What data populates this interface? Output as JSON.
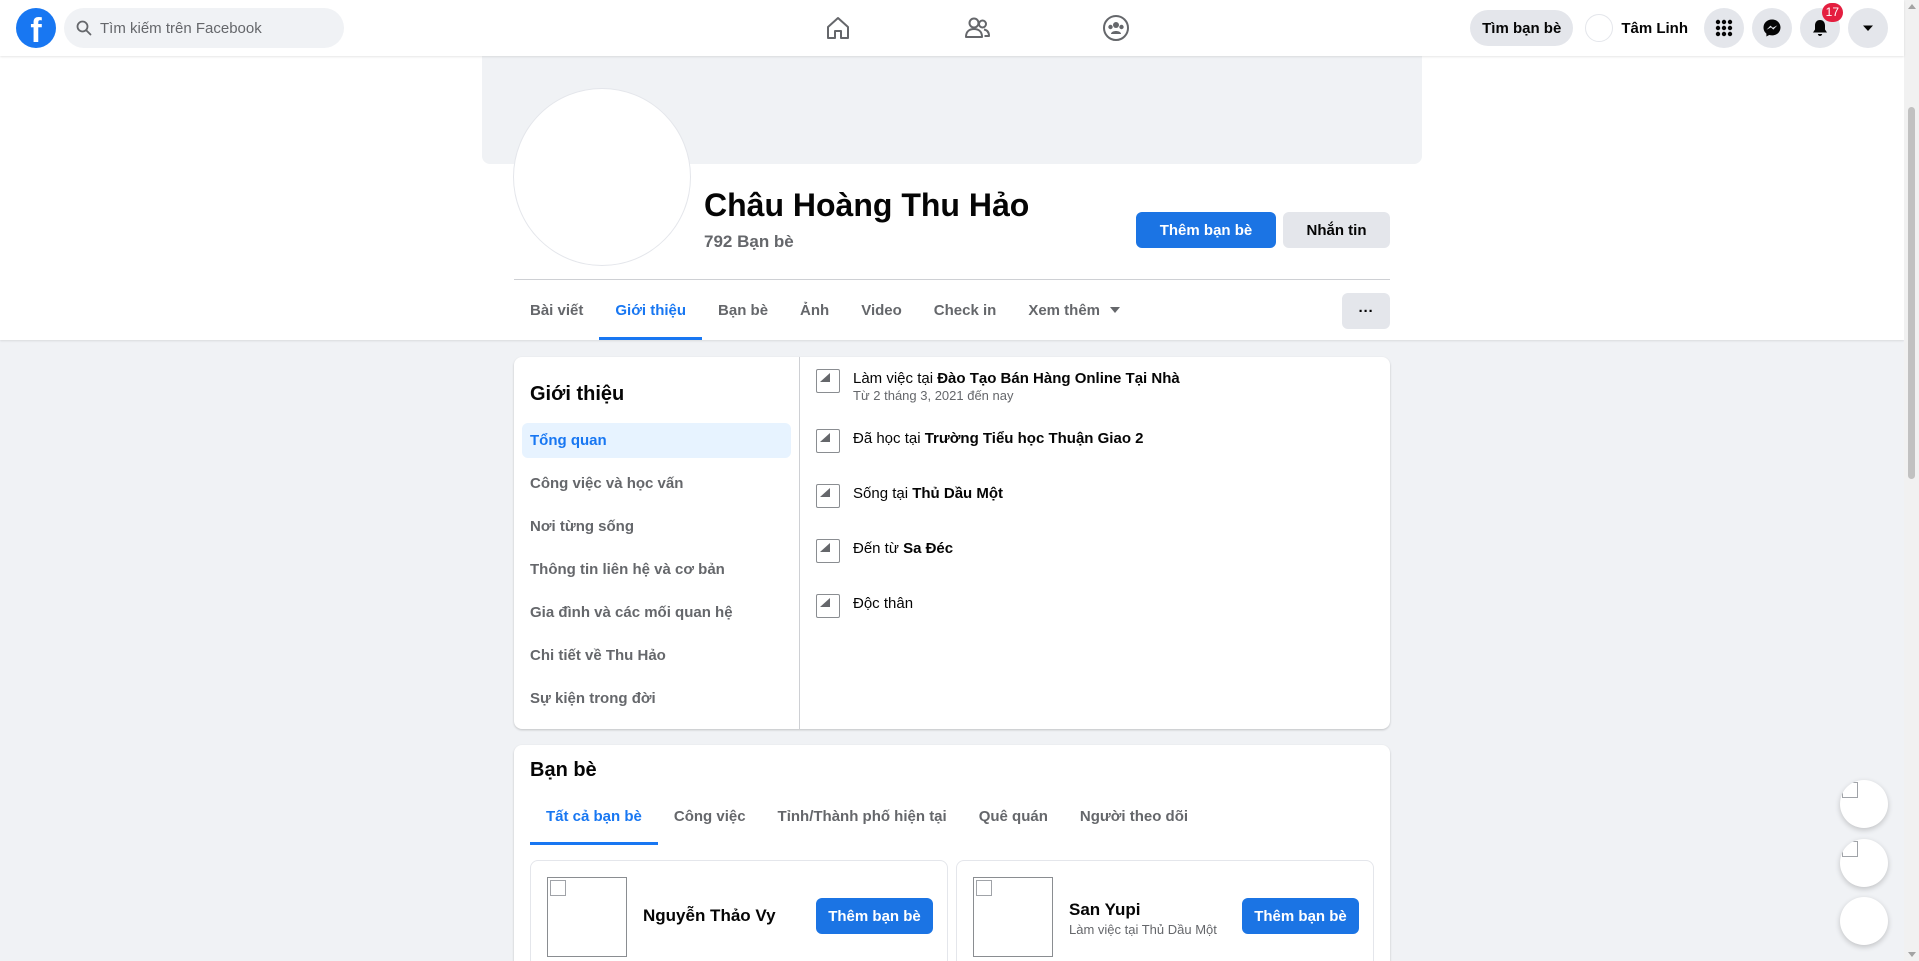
{
  "topbar": {
    "logo_letter": "f",
    "search_placeholder": "Tìm kiếm trên Facebook",
    "nav_icons": [
      "home-icon",
      "friends-icon",
      "groups-icon"
    ],
    "find_friends_label": "Tìm bạn bè",
    "user_name": "Tâm Linh",
    "notifications_count": "17"
  },
  "profile": {
    "name": "Châu Hoàng Thu Hảo",
    "friend_count": "792 Bạn bè",
    "add_friend_label": "Thêm bạn bè",
    "message_label": "Nhắn tin",
    "more_label": "···",
    "tabs": [
      {
        "label": "Bài viết",
        "active": false
      },
      {
        "label": "Giới thiệu",
        "active": true
      },
      {
        "label": "Bạn bè",
        "active": false
      },
      {
        "label": "Ảnh",
        "active": false
      },
      {
        "label": "Video",
        "active": false
      },
      {
        "label": "Check in",
        "active": false
      },
      {
        "label": "Xem thêm",
        "active": false
      }
    ]
  },
  "about": {
    "title": "Giới thiệu",
    "nav": [
      {
        "label": "Tổng quan",
        "active": true
      },
      {
        "label": "Công việc và học vấn",
        "active": false
      },
      {
        "label": "Nơi từng sống",
        "active": false
      },
      {
        "label": "Thông tin liên hệ và cơ bản",
        "active": false
      },
      {
        "label": "Gia đình và các mối quan hệ",
        "active": false
      },
      {
        "label": "Chi tiết về Thu Hảo",
        "active": false
      },
      {
        "label": "Sự kiện trong đời",
        "active": false
      }
    ],
    "rows": [
      {
        "prefix": "Làm việc tại ",
        "bold": "Đào Tạo Bán Hàng Online Tại Nhà",
        "sub": "Từ 2 tháng 3, 2021 đến nay"
      },
      {
        "prefix": "Đã học tại ",
        "bold": "Trường Tiểu học Thuận Giao 2",
        "sub": ""
      },
      {
        "prefix": "Sống tại ",
        "bold": "Thủ Dầu Một",
        "sub": ""
      },
      {
        "prefix": "Đến từ ",
        "bold": "Sa Đéc",
        "sub": ""
      },
      {
        "prefix": "Độc thân",
        "bold": "",
        "sub": ""
      }
    ]
  },
  "friends": {
    "title": "Bạn bè",
    "tabs": [
      {
        "label": "Tất cả bạn bè",
        "active": true
      },
      {
        "label": "Công việc",
        "active": false
      },
      {
        "label": "Tỉnh/Thành phố hiện tại",
        "active": false
      },
      {
        "label": "Quê quán",
        "active": false
      },
      {
        "label": "Người theo dõi",
        "active": false
      }
    ],
    "cards": [
      {
        "name": "Nguyễn Thảo Vy",
        "sub": "",
        "button": "Thêm bạn bè"
      },
      {
        "name": "San Yupi",
        "sub": "Làm việc tại Thủ Dầu Một",
        "button": "Thêm bạn bè"
      }
    ]
  },
  "colors": {
    "accent": "#1877f2",
    "button_primary": "#1b74e4",
    "badge": "#e41e3f"
  }
}
